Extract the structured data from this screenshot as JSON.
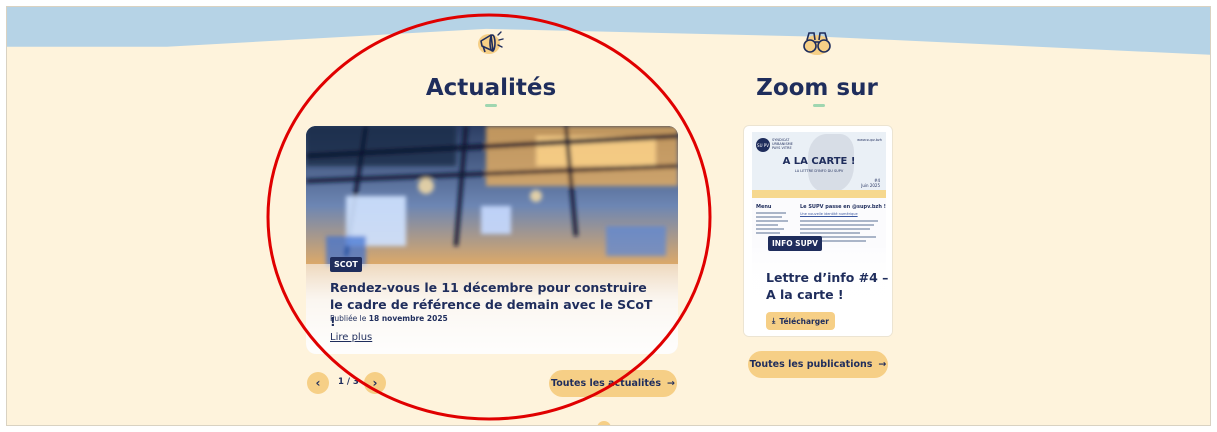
{
  "news": {
    "heading": "Actualités",
    "icon": "megaphone-icon",
    "tag": "SCOT",
    "title": "Rendez-vous le 11 décembre pour construire le cadre de référence de demain avec le SCoT !",
    "published_prefix": "Publiée le",
    "published_date": "18 novembre 2025",
    "read_more": "Lire plus",
    "pager": "1 / 3",
    "prev_icon": "chevron-left-icon",
    "next_icon": "chevron-right-icon",
    "all_button": "Toutes les actualités",
    "arrow_icon": "arrow-right-icon"
  },
  "zoom": {
    "heading": "Zoom sur",
    "icon": "binoculars-icon",
    "tag": "INFO SUPV",
    "title": "Lettre d’info #4 – A la carte !",
    "download_label": "Télécharger",
    "download_icon": "download-icon",
    "all_button": "Toutes les publications",
    "thumbnail": {
      "logo": "SU PV",
      "org": "SYNDICAT URBANISME PAYS VITRE",
      "url": "www.supv.bzh",
      "headline": "A LA CARTE !",
      "subline": "LA LETTRE D'INFO DU SUPV",
      "issue": "#4",
      "issue_date": "Juin 2025",
      "menu": "Menu",
      "article_title": "Le SUPV passe en @supv.bzh !",
      "article_sub": "Une nouvelle identité numérique"
    }
  },
  "colors": {
    "background": "#fef3dc",
    "sky": "#b6d3e6",
    "navy": "#1f2d5c",
    "accent": "#f6cf86",
    "underline": "#9fd6b0",
    "annotation": "#e00000"
  }
}
